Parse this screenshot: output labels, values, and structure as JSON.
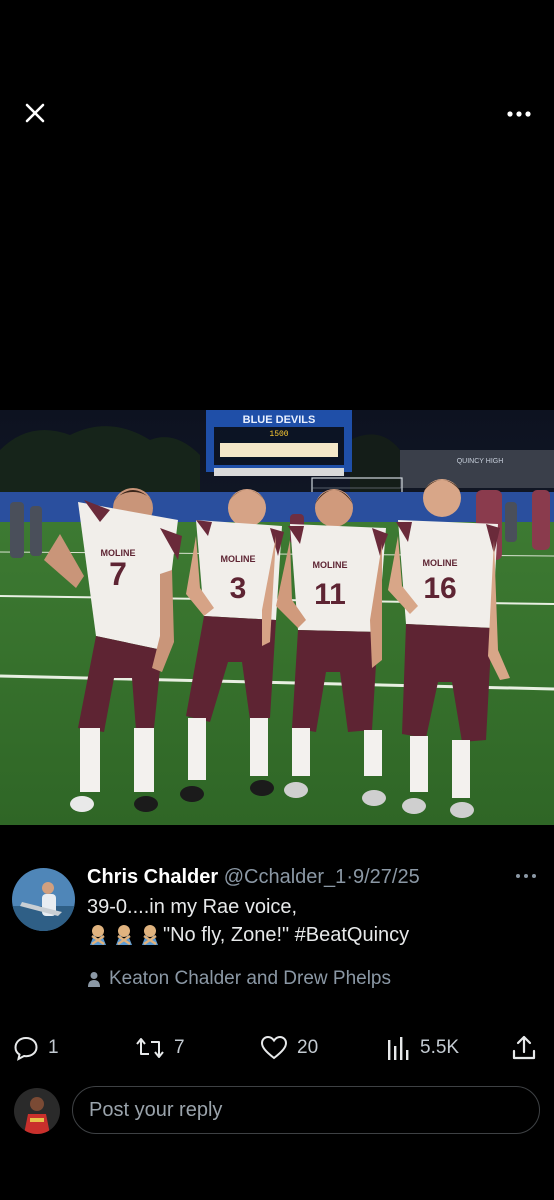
{
  "tweet": {
    "author_name": "Chris Chalder",
    "handle": "@Cchalder_1",
    "separator": "·",
    "date": "9/27/25",
    "text_line1": "39-0....in my Rae voice,",
    "text_line2": "\"No fly, Zone!\" #BeatQuincy",
    "emojis": [
      "person-gesturing-no",
      "person-gesturing-no",
      "person-gesturing-no"
    ],
    "tagged_people": "Keaton Chalder and Drew Phelps"
  },
  "actions": {
    "replies": "1",
    "reposts": "7",
    "likes": "20",
    "views": "5.5K"
  },
  "photo": {
    "scoreboard_heading": "BLUE DEVILS",
    "scoreboard_time": "1500",
    "banner_text": "QUINCY HIGH",
    "team_name": "MOLINE",
    "jersey_numbers": [
      "7",
      "3",
      "11",
      "16"
    ]
  },
  "reply": {
    "placeholder": "Post your reply"
  },
  "colors": {
    "background": "#000000",
    "text_primary": "#e7e9ea",
    "text_secondary": "#8b98a5",
    "jersey_maroon": "#5e2433",
    "field_green": "#3f7a2f"
  }
}
